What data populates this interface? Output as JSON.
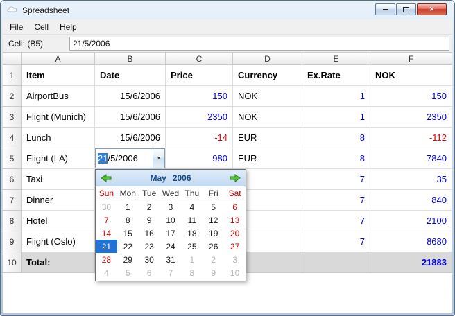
{
  "window": {
    "title": "Spreadsheet"
  },
  "icons": {
    "close": "✕",
    "dropdown": "▼"
  },
  "menu": {
    "items": [
      {
        "label": "File"
      },
      {
        "label": "Cell"
      },
      {
        "label": "Help"
      }
    ]
  },
  "cell_bar": {
    "label": "Cell: (B5)",
    "value": "21/5/2006"
  },
  "table": {
    "columns": [
      "A",
      "B",
      "C",
      "D",
      "E",
      "F"
    ],
    "header_row": {
      "num": "1",
      "item": "Item",
      "date": "Date",
      "price": "Price",
      "currency": "Currency",
      "exrate": "Ex.Rate",
      "nok": "NOK"
    },
    "rows": [
      {
        "num": "2",
        "item": "AirportBus",
        "date": "15/6/2006",
        "price": "150",
        "currency": "NOK",
        "exrate": "1",
        "nok": "150"
      },
      {
        "num": "3",
        "item": "Flight (Munich)",
        "date": "15/6/2006",
        "price": "2350",
        "currency": "NOK",
        "exrate": "1",
        "nok": "2350"
      },
      {
        "num": "4",
        "item": "Lunch",
        "date": "15/6/2006",
        "price": "-14",
        "currency": "EUR",
        "exrate": "8",
        "nok": "-112"
      },
      {
        "num": "5",
        "item": "Flight (LA)",
        "price": "980",
        "currency": "EUR",
        "exrate": "8",
        "nok": "7840"
      },
      {
        "num": "6",
        "item": "Taxi",
        "exrate": "7",
        "nok": "35"
      },
      {
        "num": "7",
        "item": "Dinner",
        "exrate": "7",
        "nok": "840"
      },
      {
        "num": "8",
        "item": "Hotel",
        "exrate": "7",
        "nok": "2100"
      },
      {
        "num": "9",
        "item": "Flight (Oslo)",
        "exrate": "7",
        "nok": "8680"
      },
      {
        "num": "10",
        "item": "Total:",
        "nok": "21883"
      }
    ]
  },
  "date_editor": {
    "selected_text": "21",
    "rest_text": "/5/2006"
  },
  "calendar": {
    "month": "May",
    "year": "2006",
    "day_names": [
      {
        "d": "Sun",
        "k": "wknd"
      },
      {
        "d": "Mon"
      },
      {
        "d": "Tue"
      },
      {
        "d": "Wed"
      },
      {
        "d": "Thu"
      },
      {
        "d": "Fri"
      },
      {
        "d": "Sat",
        "k": "wknd"
      }
    ],
    "selected_day": "21",
    "weeks": [
      [
        {
          "d": "30",
          "k": "out"
        },
        {
          "d": "1"
        },
        {
          "d": "2"
        },
        {
          "d": "3"
        },
        {
          "d": "4"
        },
        {
          "d": "5"
        },
        {
          "d": "6",
          "k": "wknd"
        }
      ],
      [
        {
          "d": "7",
          "k": "wknd"
        },
        {
          "d": "8"
        },
        {
          "d": "9"
        },
        {
          "d": "10"
        },
        {
          "d": "11"
        },
        {
          "d": "12"
        },
        {
          "d": "13",
          "k": "wknd"
        }
      ],
      [
        {
          "d": "14",
          "k": "wknd"
        },
        {
          "d": "15"
        },
        {
          "d": "16"
        },
        {
          "d": "17"
        },
        {
          "d": "18"
        },
        {
          "d": "19"
        },
        {
          "d": "20",
          "k": "wknd"
        }
      ],
      [
        {
          "d": "21",
          "k": "sel"
        },
        {
          "d": "22"
        },
        {
          "d": "23"
        },
        {
          "d": "24"
        },
        {
          "d": "25"
        },
        {
          "d": "26"
        },
        {
          "d": "27",
          "k": "wknd"
        }
      ],
      [
        {
          "d": "28",
          "k": "wknd"
        },
        {
          "d": "29"
        },
        {
          "d": "30"
        },
        {
          "d": "31"
        },
        {
          "d": "1",
          "k": "out"
        },
        {
          "d": "2",
          "k": "out"
        },
        {
          "d": "3",
          "k": "out"
        }
      ],
      [
        {
          "d": "4",
          "k": "out"
        },
        {
          "d": "5",
          "k": "out"
        },
        {
          "d": "6",
          "k": "out"
        },
        {
          "d": "7",
          "k": "out"
        },
        {
          "d": "8",
          "k": "out"
        },
        {
          "d": "9",
          "k": "out"
        },
        {
          "d": "10",
          "k": "out"
        }
      ]
    ]
  }
}
